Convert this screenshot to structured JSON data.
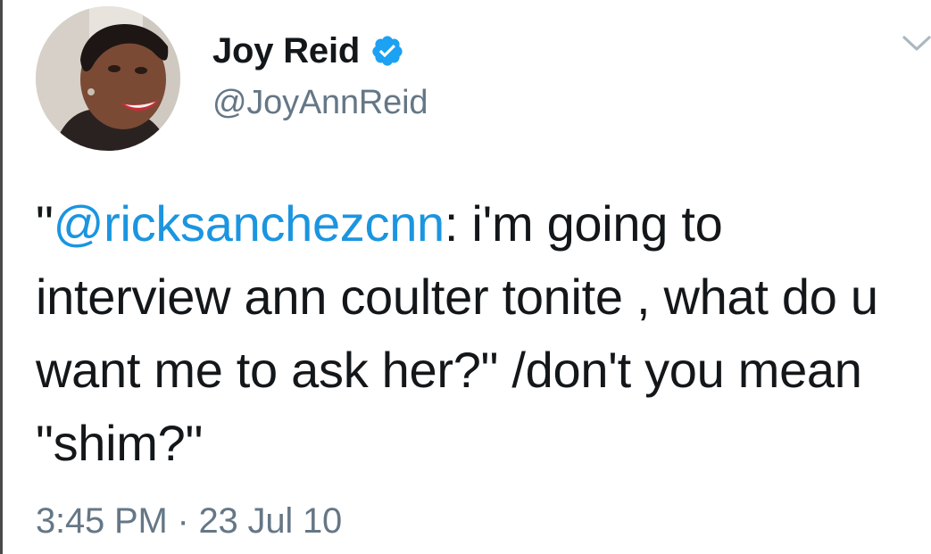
{
  "tweet": {
    "author": {
      "display_name": "Joy Reid",
      "handle": "@JoyAnnReid",
      "verified": true
    },
    "text": {
      "open_quote": "\"",
      "mention": "@ricksanchezcnn",
      "body": ": i'm going to interview ann coulter tonite , what do u want me to ask her?\" /don't you mean \"shim?\""
    },
    "timestamp": "3:45 PM · 23 Jul 10"
  },
  "colors": {
    "mention": "#1b95e0",
    "secondary_text": "#657786",
    "primary_text": "#14171a",
    "verified_badge": "#1da1f2"
  },
  "icons": {
    "verified": "verified-badge-icon",
    "menu": "chevron-down-icon"
  }
}
